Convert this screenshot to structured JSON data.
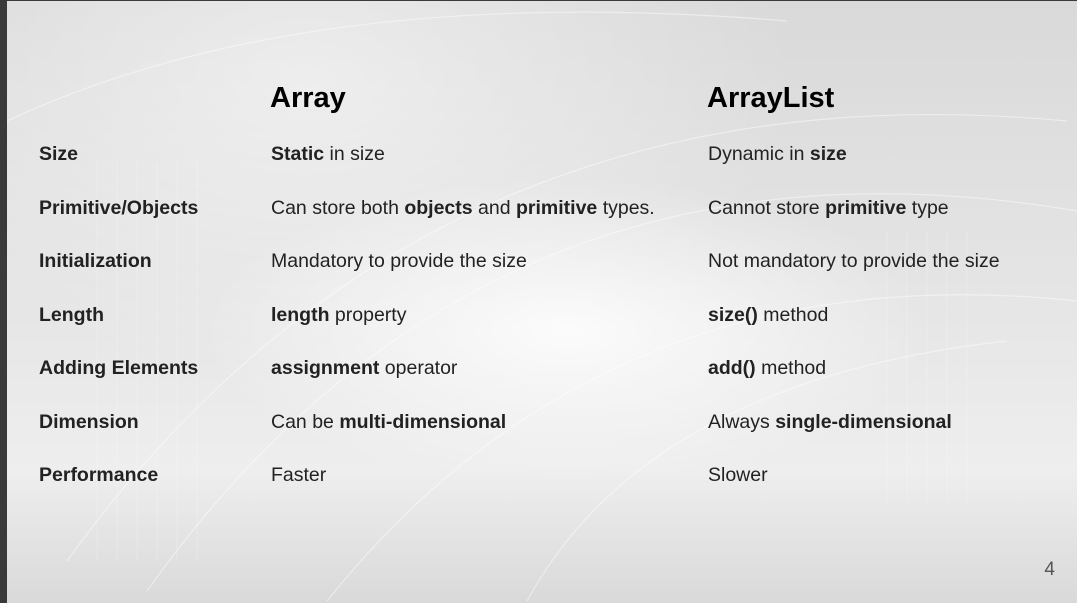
{
  "table": {
    "headers": {
      "array": "Array",
      "arraylist": "ArrayList"
    },
    "rows": [
      {
        "label": "Size",
        "array": [
          {
            "t": "Static",
            "b": true
          },
          {
            "t": " in size",
            "b": false
          }
        ],
        "arraylist": [
          {
            "t": "Dynamic in ",
            "b": false
          },
          {
            "t": "size",
            "b": true
          }
        ]
      },
      {
        "label": "Primitive/Objects",
        "array": [
          {
            "t": "Can store both ",
            "b": false
          },
          {
            "t": "objects",
            "b": true
          },
          {
            "t": " and ",
            "b": false
          },
          {
            "t": "primitive",
            "b": true
          },
          {
            "t": " types.",
            "b": false
          }
        ],
        "arraylist": [
          {
            "t": "Cannot store ",
            "b": false
          },
          {
            "t": "primitive",
            "b": true
          },
          {
            "t": " type",
            "b": false
          }
        ]
      },
      {
        "label": "Initialization",
        "array": [
          {
            "t": "Mandatory to provide the size",
            "b": false
          }
        ],
        "arraylist": [
          {
            "t": "Not mandatory to provide the size",
            "b": false
          }
        ]
      },
      {
        "label": "Length",
        "array": [
          {
            "t": "length",
            "b": true
          },
          {
            "t": " property",
            "b": false
          }
        ],
        "arraylist": [
          {
            "t": "size()",
            "b": true
          },
          {
            "t": " method",
            "b": false
          }
        ]
      },
      {
        "label": "Adding Elements",
        "array": [
          {
            "t": "assignment",
            "b": true
          },
          {
            "t": " operator",
            "b": false
          }
        ],
        "arraylist": [
          {
            "t": "add()",
            "b": true
          },
          {
            "t": " method",
            "b": false
          }
        ]
      },
      {
        "label": "Dimension",
        "array": [
          {
            "t": "Can be ",
            "b": false
          },
          {
            "t": "multi-dimensional",
            "b": true
          }
        ],
        "arraylist": [
          {
            "t": "Always ",
            "b": false
          },
          {
            "t": "single-dimensional",
            "b": true
          }
        ]
      },
      {
        "label": "Performance",
        "array": [
          {
            "t": "Faster",
            "b": false
          }
        ],
        "arraylist": [
          {
            "t": "Slower",
            "b": false
          }
        ]
      }
    ]
  },
  "page_number": "4"
}
